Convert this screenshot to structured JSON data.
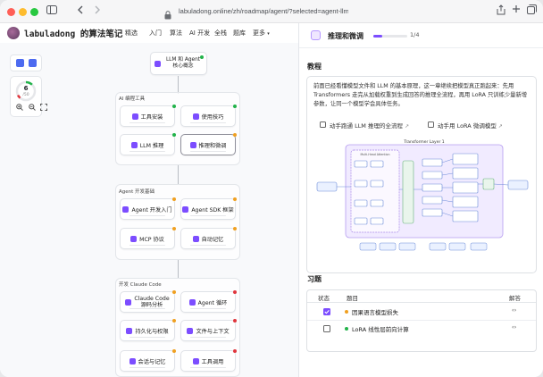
{
  "browser": {
    "url": "labuladong.online/zh/roadmap/agent/?selected=agent-llm-inference",
    "lock_icon": "lock-icon",
    "back_icon": "chevron-left-icon",
    "forward_icon": "chevron-right-icon",
    "sidebar_icon": "sidebar-icon",
    "share_icon": "share-icon",
    "new_tab_icon": "plus-icon",
    "tabs_icon": "tabs-overview-icon"
  },
  "site": {
    "brand": "labuladong 的算法笔记",
    "nav": [
      "精选",
      "入门",
      "算法",
      "AI 开发",
      "全栈",
      "题库",
      "更多"
    ],
    "more_icon": "chevron-down-icon"
  },
  "progress_widget": {
    "done": "6",
    "total": "/50",
    "value_fraction": 0.12,
    "zoom_in_icon": "zoom-in-icon",
    "zoom_out_icon": "zoom-out-icon",
    "fit_icon": "fit-screen-icon"
  },
  "roadmap": {
    "root": "LLM 和 Agent 核心概念",
    "groups": [
      {
        "title": "AI 编程工具",
        "nodes": [
          {
            "label": "工具安装",
            "status": "done"
          },
          {
            "label": "使用技巧",
            "status": "done"
          },
          {
            "label": "LLM 推理",
            "status": "done"
          },
          {
            "label": "推理和微调",
            "status": "in-progress"
          }
        ]
      },
      {
        "title": "Agent 开发基础",
        "nodes": [
          {
            "label": "Agent 开发入门",
            "status": "in-progress"
          },
          {
            "label": "Agent SDK 框架",
            "status": "in-progress"
          },
          {
            "label": "MCP 协议",
            "status": "in-progress"
          },
          {
            "label": "自动记忆",
            "status": "in-progress"
          }
        ]
      },
      {
        "title": "开发 Claude Code",
        "nodes": [
          {
            "label": "Claude Code 源码分析",
            "status": "in-progress"
          },
          {
            "label": "Agent 循环",
            "status": "todo"
          },
          {
            "label": "持久化与权限",
            "status": "in-progress"
          },
          {
            "label": "文件与上下文",
            "status": "todo"
          },
          {
            "label": "会话与记忆",
            "status": "in-progress"
          },
          {
            "label": "工具调用",
            "status": "todo"
          }
        ]
      }
    ],
    "colors": {
      "done": "#22b34a",
      "in-progress": "#f0a020",
      "todo": "#e0353c"
    }
  },
  "panel": {
    "title": "推理和微调",
    "step_fraction": 0.25,
    "step_text": "1/4",
    "tutorial_heading": "教程",
    "tutorial_text": "前面已经看懂模型文件和 LLM 的基本原理，这一章继续把模型真正跑起来：先用 Transformers 走完从加载权重到生成回答的推理全流程，再用 LoRA 只训练少量新增参数，让同一个模型学会具体任务。",
    "links": [
      {
        "label": "动手跑通 LLM 推理的全流程",
        "icon": "external-link-icon"
      },
      {
        "label": "动手用 LoRA 微调模型",
        "icon": "external-link-icon"
      }
    ],
    "figure": {
      "title": "Transformer Layer 1",
      "sub_title": "Multi-Head Attention"
    },
    "exercise_heading": "习题",
    "exercise_columns": [
      "状态",
      "题目",
      "解答"
    ],
    "exercises": [
      {
        "title": "因果语言模型损失",
        "done": true,
        "difficulty": "#f0a020",
        "solution_icon": "code-brackets-icon"
      },
      {
        "title": "LoRA 线性层前向计算",
        "done": false,
        "difficulty": "#22b34a",
        "solution_icon": "code-brackets-icon"
      }
    ],
    "accent": "#7c4dff"
  }
}
